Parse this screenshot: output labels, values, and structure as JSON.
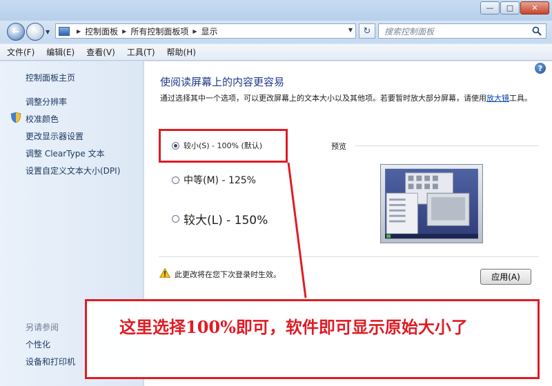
{
  "window": {
    "minimize_glyph": "—",
    "maximize_glyph": "□",
    "close_glyph": "✕"
  },
  "nav": {
    "back_glyph": "←",
    "forward_glyph": "→",
    "breadcrumb": [
      "控制面板",
      "所有控制面板项",
      "显示"
    ],
    "refresh_glyph": "↻",
    "search_placeholder": "搜索控制面板"
  },
  "menu": [
    "文件(F)",
    "编辑(E)",
    "查看(V)",
    "工具(T)",
    "帮助(H)"
  ],
  "sidebar": {
    "links": [
      "控制面板主页",
      "调整分辨率",
      "校准颜色",
      "更改显示器设置",
      "调整 ClearType 文本",
      "设置自定义文本大小(DPI)"
    ],
    "see_also_heading": "另请参阅",
    "see_also_links": [
      "个性化",
      "设备和打印机"
    ]
  },
  "main": {
    "title": "使阅读屏幕上的内容更容易",
    "description_prefix": "通过选择其中一个选项，可以更改屏幕上的文本大小以及其他项。若要暂时放大部分屏幕，请使用",
    "description_link": "放大镜",
    "description_suffix": "工具。",
    "options": [
      {
        "label": "较小(S) - 100% (默认)",
        "selected": true
      },
      {
        "label": "中等(M) - 125%",
        "selected": false
      },
      {
        "label": "较大(L) - 150%",
        "selected": false
      }
    ],
    "preview_label": "预览",
    "warning": "此更改将在您下次登录时生效。",
    "apply_label": "应用(A)"
  },
  "annotation": {
    "text": "这里选择100%即可，软件即可显示原始大小了",
    "color": "#e01b24"
  },
  "help_glyph": "?"
}
